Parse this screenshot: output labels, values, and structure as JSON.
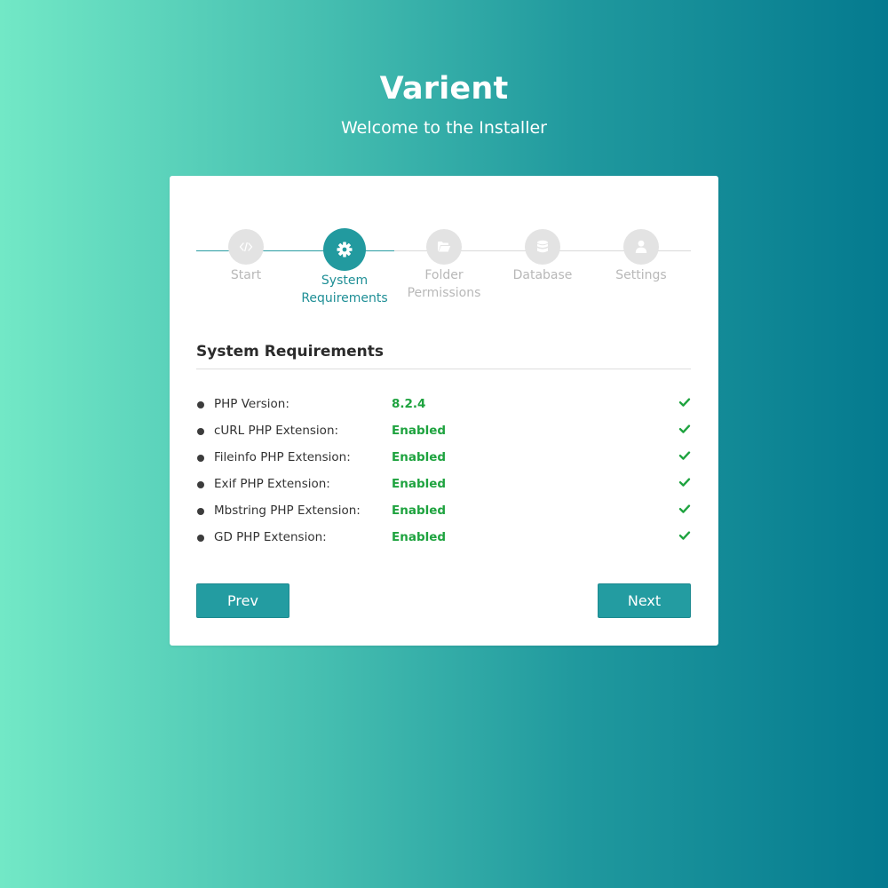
{
  "header": {
    "title": "Varient",
    "subtitle": "Welcome to the Installer"
  },
  "stepper": {
    "active_index": 1,
    "steps": [
      {
        "label": "Start",
        "icon": "code-icon"
      },
      {
        "label": "System\nRequirements",
        "icon": "gear-icon"
      },
      {
        "label": "Folder\nPermissions",
        "icon": "folder-open-icon"
      },
      {
        "label": "Database",
        "icon": "database-icon"
      },
      {
        "label": "Settings",
        "icon": "user-icon"
      }
    ]
  },
  "section": {
    "heading": "System Requirements"
  },
  "requirements": [
    {
      "name": "PHP Version:",
      "value": "8.2.4"
    },
    {
      "name": "cURL PHP Extension:",
      "value": "Enabled"
    },
    {
      "name": "Fileinfo PHP Extension:",
      "value": "Enabled"
    },
    {
      "name": "Exif PHP Extension:",
      "value": "Enabled"
    },
    {
      "name": "Mbstring PHP Extension:",
      "value": "Enabled"
    },
    {
      "name": "GD PHP Extension:",
      "value": "Enabled"
    }
  ],
  "buttons": {
    "prev_label": "Prev",
    "next_label": "Next"
  },
  "colors": {
    "accent": "#229a9f",
    "success": "#1ea33f",
    "inactive_step": "#e3e3e3",
    "gradient_start": "#72e8c6",
    "gradient_end": "#047a8f"
  }
}
